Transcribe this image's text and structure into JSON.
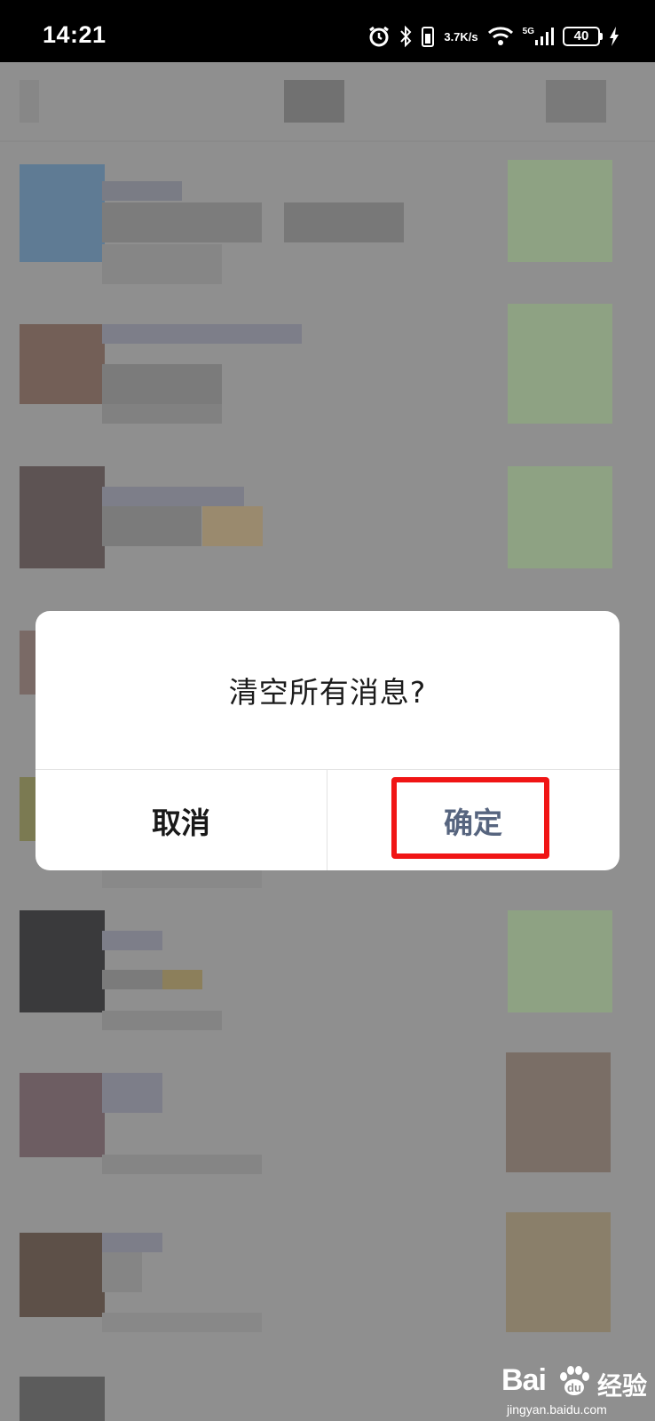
{
  "status_bar": {
    "time": "14:21",
    "speed_top": "3.7",
    "speed_bottom": "K/s",
    "network": "5G",
    "battery": "40",
    "icons": [
      "alarm-icon",
      "bluetooth-icon",
      "vibrate-icon",
      "wifi-icon",
      "signal-icon",
      "battery-icon",
      "charging-icon"
    ]
  },
  "dialog": {
    "title": "清空所有消息?",
    "cancel_label": "取消",
    "confirm_label": "确定"
  },
  "watermark": {
    "logo": "Bai",
    "logo_suffix": "经验",
    "url": "jingyan.baidu.com"
  },
  "colors": {
    "overlay": "#8f8f8f",
    "dialog_bg": "#ffffff",
    "confirm_text": "#57657f",
    "highlight": "#f01515"
  }
}
